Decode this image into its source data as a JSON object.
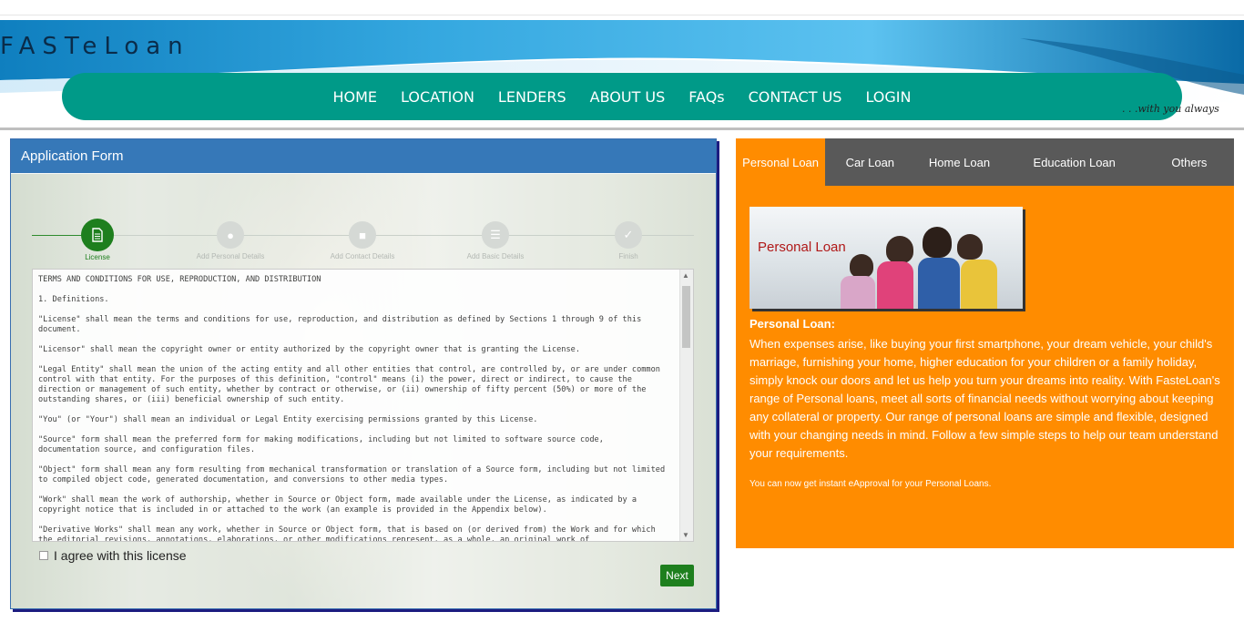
{
  "brand": {
    "logo": "FASTeLoan",
    "tagline": ". . .with you always"
  },
  "nav": {
    "items": [
      "HOME",
      "LOCATION",
      "LENDERS",
      "ABOUT US",
      "FAQs",
      "CONTACT US",
      "LOGIN"
    ]
  },
  "form": {
    "title": "Application Form",
    "steps": [
      {
        "label": "License",
        "icon": "document-icon",
        "active": true
      },
      {
        "label": "Add Personal Details",
        "icon": "person-icon",
        "active": false
      },
      {
        "label": "Add Contact Details",
        "icon": "contact-card-icon",
        "active": false
      },
      {
        "label": "Add Basic Details",
        "icon": "list-icon",
        "active": false
      },
      {
        "label": "Finish",
        "icon": "check-icon",
        "active": false
      }
    ],
    "license_paragraphs": [
      "TERMS AND CONDITIONS FOR USE, REPRODUCTION, AND DISTRIBUTION",
      "1. Definitions.",
      "\"License\" shall mean the terms and conditions for use, reproduction, and distribution as defined by Sections 1 through 9 of this document.",
      "\"Licensor\" shall mean the copyright owner or entity authorized by the copyright owner that is granting the License.",
      "\"Legal Entity\" shall mean the union of the acting entity and all other entities that control, are controlled by, or are under common control with that entity. For the purposes of this definition, \"control\" means (i) the power, direct or indirect, to cause the direction or management of such entity, whether by contract or otherwise, or (ii) ownership of fifty percent (50%) or more of the outstanding shares, or (iii) beneficial ownership of such entity.",
      "\"You\" (or \"Your\") shall mean an individual or Legal Entity exercising permissions granted by this License.",
      "\"Source\" form shall mean the preferred form for making modifications, including but not limited to software source code, documentation source, and configuration files.",
      "\"Object\" form shall mean any form resulting from mechanical transformation or translation of a Source form, including but not limited to compiled object code, generated documentation, and conversions to other media types.",
      "\"Work\" shall mean the work of authorship, whether in Source or Object form, made available under the License, as indicated by a copyright notice that is included in or attached to the work (an example is provided in the Appendix below).",
      "\"Derivative Works\" shall mean any work, whether in Source or Object form, that is based on (or derived from) the Work and for which the editorial revisions, annotations, elaborations, or other modifications represent, as a whole, an original work of"
    ],
    "agree_label": "I agree with this license",
    "next_label": "Next"
  },
  "loan": {
    "tabs": [
      "Personal Loan",
      "Car Loan",
      "Home Loan",
      "Education Loan",
      "Others"
    ],
    "active_tab": 0,
    "image_caption": "Personal Loan",
    "title": "Personal Loan:",
    "description": "When expenses arise, like buying your first smartphone, your dream vehicle, your child's marriage, furnishing your home, higher education for your children or a family holiday, simply knock our doors and let us help you turn your dreams into reality. With FasteLoan's range of Personal loans, meet all sorts of financial needs without worrying about keeping any collateral or property. Our range of personal loans are simple and flexible, designed with your changing needs in mind. Follow a few simple steps to help our team understand your requirements.",
    "note": "You can now get instant eApproval for your Personal Loans."
  },
  "colors": {
    "nav": "#009a88",
    "panel_header": "#3678b8",
    "step_active": "#1e7f1e",
    "loan_bg": "#ff8c00",
    "tab_bg": "#595959"
  }
}
